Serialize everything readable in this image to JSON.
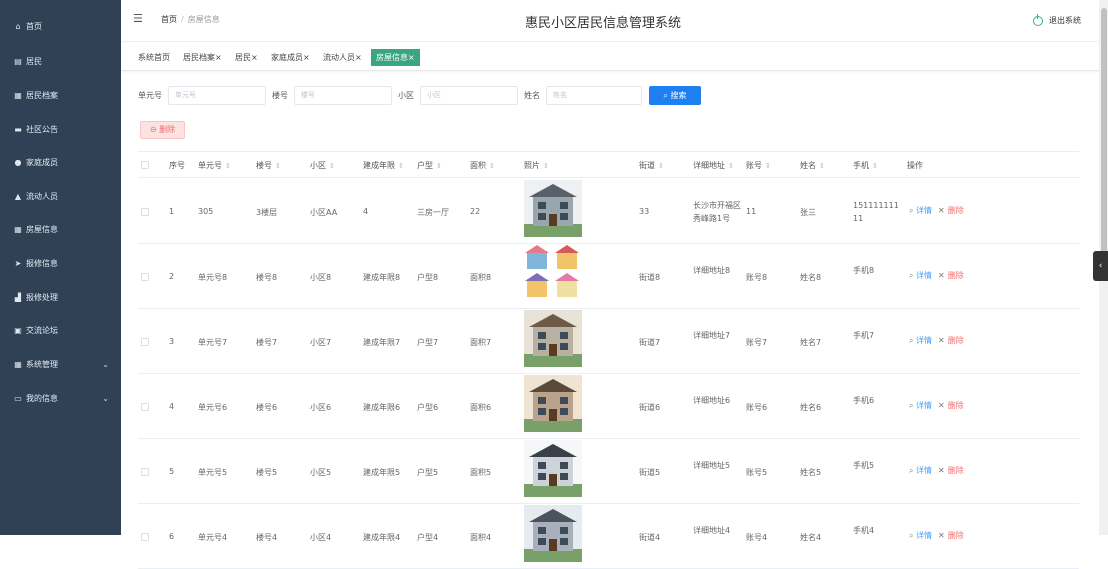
{
  "sidebar": {
    "items": [
      {
        "icon": "home-icon",
        "glyph": "⌂",
        "label": "首页"
      },
      {
        "icon": "list-icon",
        "glyph": "▤",
        "label": "居民"
      },
      {
        "icon": "grid-icon",
        "glyph": "▦",
        "label": "居民档案"
      },
      {
        "icon": "monitor-icon",
        "glyph": "▬",
        "label": "社区公告"
      },
      {
        "icon": "pin-icon",
        "glyph": "●",
        "label": "家庭成员"
      },
      {
        "icon": "user-icon",
        "glyph": "▲",
        "label": "流动人员"
      },
      {
        "icon": "grid-icon",
        "glyph": "▦",
        "label": "房屋信息"
      },
      {
        "icon": "send-icon",
        "glyph": "➤",
        "label": "报修信息"
      },
      {
        "icon": "chart-icon",
        "glyph": "▟",
        "label": "报修处理"
      },
      {
        "icon": "chat-icon",
        "glyph": "▣",
        "label": "交流论坛"
      },
      {
        "icon": "grid-icon",
        "glyph": "▦",
        "label": "系统管理",
        "expand": "⌄"
      },
      {
        "icon": "window-icon",
        "glyph": "▭",
        "label": "我的信息",
        "expand": "⌄"
      }
    ]
  },
  "header": {
    "menu_glyph": "☰",
    "breadcrumb_home": "首页",
    "breadcrumb_sep": "/",
    "breadcrumb_current": "房屋信息",
    "title": "惠民小区居民信息管理系统",
    "logout": "退出系统"
  },
  "tags": [
    "系统首页",
    "居民档案×",
    "居民×",
    "家庭成员×",
    "流动人员×",
    "房屋信息×"
  ],
  "search": {
    "fields": [
      {
        "label": "单元号",
        "placeholder": "单元号"
      },
      {
        "label": "楼号",
        "placeholder": "楼号"
      },
      {
        "label": "小区",
        "placeholder": "小区"
      },
      {
        "label": "姓名",
        "placeholder": "姓名"
      }
    ],
    "button": "搜索",
    "button_glyph": "⌕"
  },
  "delete_button": "删除",
  "delete_glyph": "⊖",
  "table": {
    "columns": [
      "序号",
      "单元号",
      "楼号",
      "小区",
      "建成年限",
      "户型",
      "面积",
      "照片",
      "街道",
      "详细地址",
      "账号",
      "姓名",
      "手机",
      "操作"
    ],
    "sort_glyph": "⇕",
    "rows": [
      {
        "no": "1",
        "unit": "305",
        "building": "3楼层",
        "community": "小区AA",
        "years": "4",
        "type": "三房一厅",
        "area": "22",
        "street": "33",
        "address": "长沙市开福区秀峰路1号",
        "account": "11",
        "name": "张三",
        "phone": "15111111111"
      },
      {
        "no": "2",
        "unit": "单元号8",
        "building": "楼号8",
        "community": "小区8",
        "years": "建成年限8",
        "type": "户型8",
        "area": "面积8",
        "street": "街道8",
        "address": "详细地址8",
        "account": "账号8",
        "name": "姓名8",
        "phone": "手机8"
      },
      {
        "no": "3",
        "unit": "单元号7",
        "building": "楼号7",
        "community": "小区7",
        "years": "建成年限7",
        "type": "户型7",
        "area": "面积7",
        "street": "街道7",
        "address": "详细地址7",
        "account": "账号7",
        "name": "姓名7",
        "phone": "手机7"
      },
      {
        "no": "4",
        "unit": "单元号6",
        "building": "楼号6",
        "community": "小区6",
        "years": "建成年限6",
        "type": "户型6",
        "area": "面积6",
        "street": "街道6",
        "address": "详细地址6",
        "account": "账号6",
        "name": "姓名6",
        "phone": "手机6"
      },
      {
        "no": "5",
        "unit": "单元号5",
        "building": "楼号5",
        "community": "小区5",
        "years": "建成年限5",
        "type": "户型5",
        "area": "面积5",
        "street": "街道5",
        "address": "详细地址5",
        "account": "账号5",
        "name": "姓名5",
        "phone": "手机5"
      },
      {
        "no": "6",
        "unit": "单元号4",
        "building": "楼号4",
        "community": "小区4",
        "years": "建成年限4",
        "type": "户型4",
        "area": "面积4",
        "street": "街道4",
        "address": "详细地址4",
        "account": "账号4",
        "name": "姓名4",
        "phone": "手机4"
      }
    ],
    "op_detail": "详情",
    "op_delete": "删除",
    "op_detail_glyph": "⌕",
    "op_delete_glyph": "✕"
  },
  "side_toggle": "‹",
  "colors": {
    "sidebar": "#304156",
    "accent": "#3aa681",
    "primary": "#1e7ff0",
    "danger": "#f56c6c"
  }
}
